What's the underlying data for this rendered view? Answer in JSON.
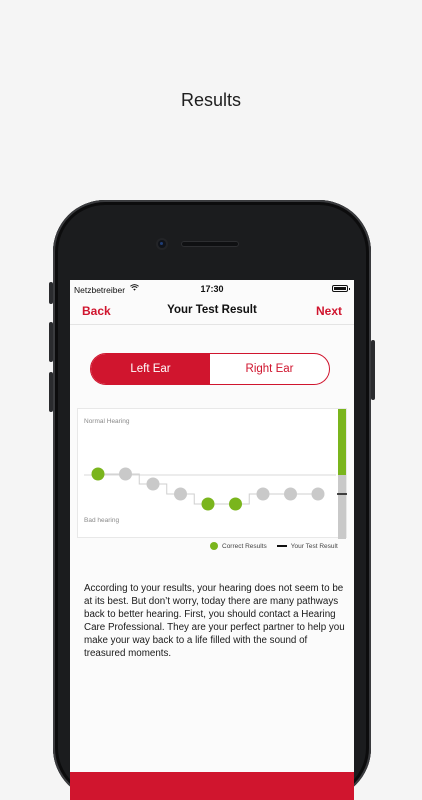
{
  "caption": "Results",
  "status_bar": {
    "carrier": "Netzbetreiber",
    "time": "17:30"
  },
  "nav": {
    "back_label": "Back",
    "title": "Your Test Result",
    "next_label": "Next"
  },
  "ear_tabs": {
    "left_label": "Left Ear",
    "right_label": "Right Ear",
    "selected": "Left Ear"
  },
  "chart_data": {
    "type": "scatter",
    "top_label": "Normal Hearing",
    "bottom_label": "Bad hearing",
    "points": [
      {
        "x": 1,
        "y": 0,
        "correct": true
      },
      {
        "x": 2,
        "y": 0,
        "correct": false
      },
      {
        "x": 3,
        "y": -1,
        "correct": false
      },
      {
        "x": 4,
        "y": -2,
        "correct": false
      },
      {
        "x": 5,
        "y": -3,
        "correct": true
      },
      {
        "x": 6,
        "y": -3,
        "correct": true
      },
      {
        "x": 7,
        "y": -2,
        "correct": false
      },
      {
        "x": 8,
        "y": -2,
        "correct": false
      },
      {
        "x": 9,
        "y": -2,
        "correct": false
      }
    ],
    "legend": {
      "correct_label": "Correct Results",
      "result_label": "Your Test Result"
    },
    "colors": {
      "correct": "#7ab51d",
      "other": "#c9c9c9",
      "accent": "#d0152e"
    }
  },
  "result_text": "According to your results, your hearing does not seem to be at its best. But don’t worry, today there are many pathways back to better hearing. First, you should contact a Hearing Care Professional. They are your perfect partner to help you make your way back to a life filled with the sound of treasured moments."
}
